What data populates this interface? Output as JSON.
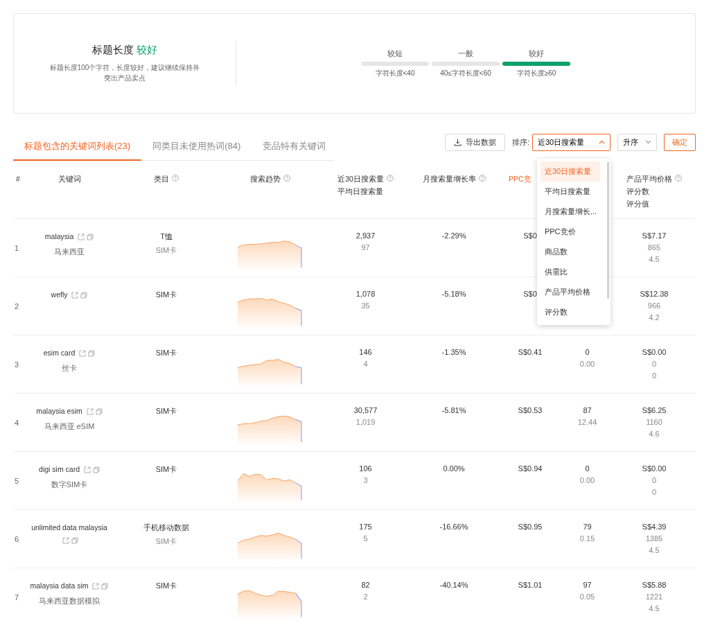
{
  "summary": {
    "title": "标题长度",
    "rating": "较好",
    "description": "标题长度100个字符，长度较好，建议继续保持并突出产品卖点",
    "levels": [
      {
        "label": "较短",
        "range": "字符长度<40",
        "selected": false
      },
      {
        "label": "一般",
        "range": "40≤字符长度<60",
        "selected": false
      },
      {
        "label": "较好",
        "range": "字符长度≥60",
        "selected": true
      }
    ]
  },
  "tabs": [
    {
      "label": "标题包含的关键词列表(23)",
      "selected": true
    },
    {
      "label": "同类目未使用热词(84)",
      "selected": false
    },
    {
      "label": "竞品特有关键词",
      "selected": false
    }
  ],
  "toolbar": {
    "export_button": "导出数据",
    "sort_label": "排序:",
    "sort_select": {
      "value": "近30日搜索量",
      "expanded": true
    },
    "order_select": "升序",
    "confirm_button": "确定"
  },
  "sort_options": [
    {
      "label": "近30日搜索量",
      "selected": true
    },
    {
      "label": "平均日搜索量",
      "selected": false
    },
    {
      "label": "月搜索量增长...",
      "selected": false
    },
    {
      "label": "PPC竞价",
      "selected": false
    },
    {
      "label": "商品数",
      "selected": false
    },
    {
      "label": "供需比",
      "selected": false
    },
    {
      "label": "产品平均价格",
      "selected": false
    },
    {
      "label": "评分数",
      "selected": false
    }
  ],
  "table": {
    "columns": [
      {
        "lines": [
          "#"
        ],
        "help": false,
        "highlighted": false
      },
      {
        "lines": [
          "关键词"
        ],
        "help": false,
        "highlighted": false
      },
      {
        "lines": [
          "类目"
        ],
        "help": true,
        "highlighted": false
      },
      {
        "lines": [
          "搜索趋势"
        ],
        "help": true,
        "highlighted": false
      },
      {
        "lines": [
          "近30日搜索量",
          "平均日搜索量"
        ],
        "help": true,
        "highlighted": false
      },
      {
        "lines": [
          "月搜索量增长率"
        ],
        "help": true,
        "highlighted": false
      },
      {
        "lines": [
          "PPC竞"
        ],
        "help": false,
        "highlighted": true
      },
      {
        "lines": [
          "产品平均价格",
          "评分数",
          "评分值"
        ],
        "help": true,
        "highlighted": false
      }
    ],
    "rows": [
      {
        "index": "1",
        "keyword": "malaysia",
        "translation": "马来西亚",
        "category": [
          "T恤",
          "SIM卡"
        ],
        "search": [
          "2,937",
          "97"
        ],
        "growth": "-2.29%",
        "ppc": "S$0",
        "price": [
          "S$7.17",
          "865",
          "4.5"
        ]
      },
      {
        "index": "2",
        "keyword": "wefly",
        "category": [
          "SIM卡"
        ],
        "search": [
          "1,078",
          "35"
        ],
        "growth": "-5.18%",
        "ppc": "S$0",
        "price": [
          "S$12.38",
          "966",
          "4.2"
        ]
      },
      {
        "index": "3",
        "keyword": "esim card",
        "translation": "丝卡",
        "category": [
          "SIM卡"
        ],
        "search": [
          "146",
          "4"
        ],
        "growth": "-1.35%",
        "ppc": "S$0.41",
        "column_8": [
          "0",
          "0.00"
        ],
        "price": [
          "S$0.00",
          "0",
          "0"
        ]
      },
      {
        "index": "4",
        "keyword": "malaysia esim",
        "translation": "马来西亚 eSIM",
        "category": [
          "SIM卡"
        ],
        "search": [
          "30,577",
          "1,019"
        ],
        "growth": "-5.81%",
        "ppc": "S$0.53",
        "column_8": [
          "87",
          "12.44"
        ],
        "price": [
          "S$6.25",
          "1160",
          "4.6"
        ]
      },
      {
        "index": "5",
        "keyword": "digi sim card",
        "translation": "数字SIM卡",
        "category": [
          "SIM卡"
        ],
        "search": [
          "106",
          "3"
        ],
        "growth": "0.00%",
        "ppc": "S$0.94",
        "column_8": [
          "0",
          "0.00"
        ],
        "price": [
          "S$0.00",
          "0",
          "0"
        ]
      },
      {
        "index": "6",
        "keyword": "unlimited data malaysia",
        "category": [
          "手机移动数据",
          "SIM卡"
        ],
        "search": [
          "175",
          "5"
        ],
        "growth": "-16.66%",
        "ppc": "S$0.95",
        "column_8": [
          "79",
          "0.15"
        ],
        "price": [
          "S$4.39",
          "1385",
          "4.5"
        ]
      },
      {
        "index": "7",
        "keyword": "malaysia data sim",
        "translation": "马来西亚数据模拟",
        "category": [
          "SIM卡"
        ],
        "search": [
          "82",
          "2"
        ],
        "growth": "-40.14%",
        "ppc": "S$1.01",
        "column_8": [
          "97",
          "0.05"
        ],
        "price": [
          "S$5.88",
          "1221",
          "4.5"
        ]
      }
    ]
  }
}
